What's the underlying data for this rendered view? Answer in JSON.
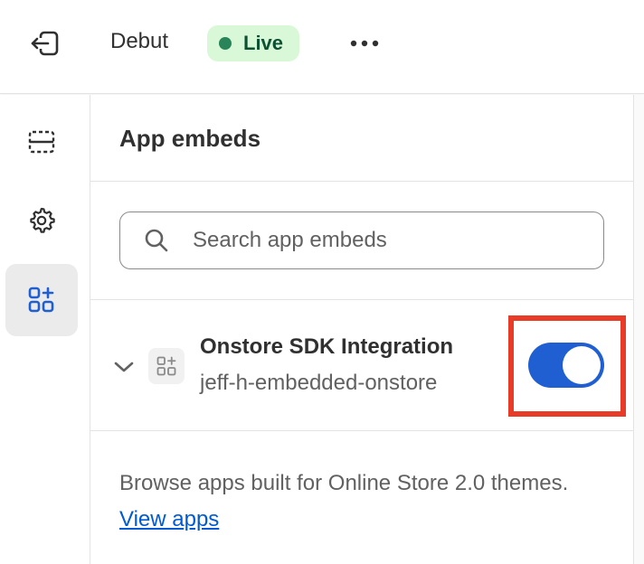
{
  "topbar": {
    "exit_icon": "exit-icon",
    "theme_name": "Debut",
    "status_badge": "Live",
    "status_color": "#29845a",
    "more_icon": "more-horizontal-icon"
  },
  "rail": {
    "items": [
      {
        "icon": "sections-icon",
        "active": false
      },
      {
        "icon": "settings-gear-icon",
        "active": false
      },
      {
        "icon": "app-embeds-icon",
        "active": true
      }
    ]
  },
  "panel": {
    "title": "App embeds",
    "search": {
      "placeholder": "Search app embeds",
      "value": ""
    },
    "embeds": [
      {
        "name": "Onstore SDK Integration",
        "handle": "jeff-h-embedded-onstore",
        "enabled": true,
        "toggle_color": "#1f5fd1"
      }
    ],
    "footer": {
      "text": "Browse apps built for Online Store 2.0 themes.",
      "link_label": "View apps"
    }
  },
  "highlight_color": "#e83b28"
}
